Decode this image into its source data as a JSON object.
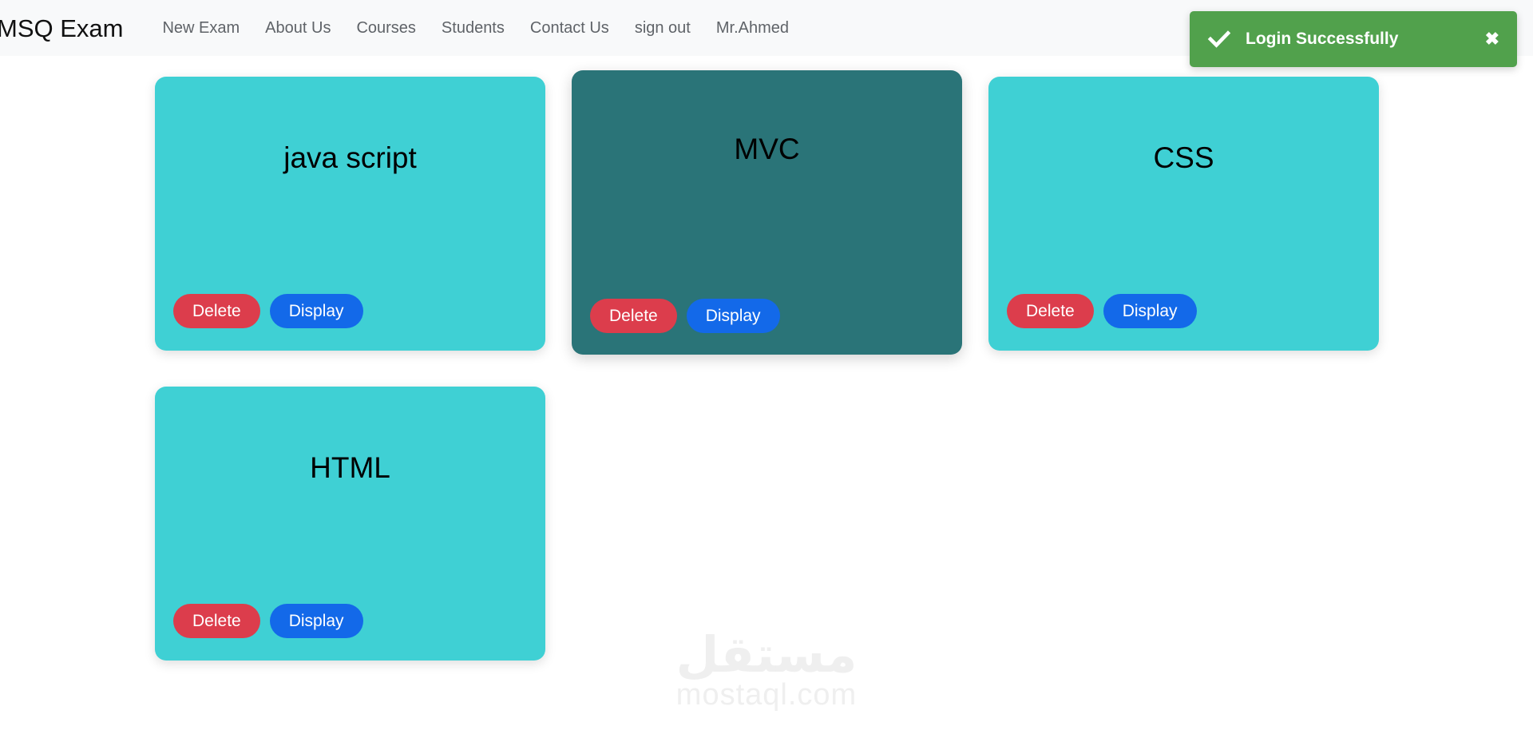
{
  "navbar": {
    "brand": "MSQ Exam",
    "links": [
      {
        "label": "New Exam"
      },
      {
        "label": "About Us"
      },
      {
        "label": "Courses"
      },
      {
        "label": "Students"
      },
      {
        "label": "Contact Us"
      },
      {
        "label": "sign out"
      },
      {
        "label": "Mr.Ahmed"
      }
    ],
    "background_color": "#f8f9fa",
    "link_color": "#5f6368"
  },
  "cards": [
    {
      "title": "java script",
      "color": "#3fd0d4",
      "delete_label": "Delete",
      "display_label": "Display"
    },
    {
      "title": "MVC",
      "color": "#2a7478",
      "delete_label": "Delete",
      "display_label": "Display"
    },
    {
      "title": "CSS",
      "color": "#3fd0d4",
      "delete_label": "Delete",
      "display_label": "Display"
    },
    {
      "title": "HTML",
      "color": "#3fd0d4",
      "delete_label": "Delete",
      "display_label": "Display"
    }
  ],
  "buttons": {
    "delete_color": "#dc3d4c",
    "display_color": "#1369e9"
  },
  "toast": {
    "message": "Login Successfully",
    "icon": "check-icon",
    "close_label": "✖",
    "background_color": "#51a14c",
    "text_color": "#ffffff"
  },
  "watermark": {
    "arabic": "مستقل",
    "latin": "mostaql.com",
    "color": "#efefef"
  }
}
